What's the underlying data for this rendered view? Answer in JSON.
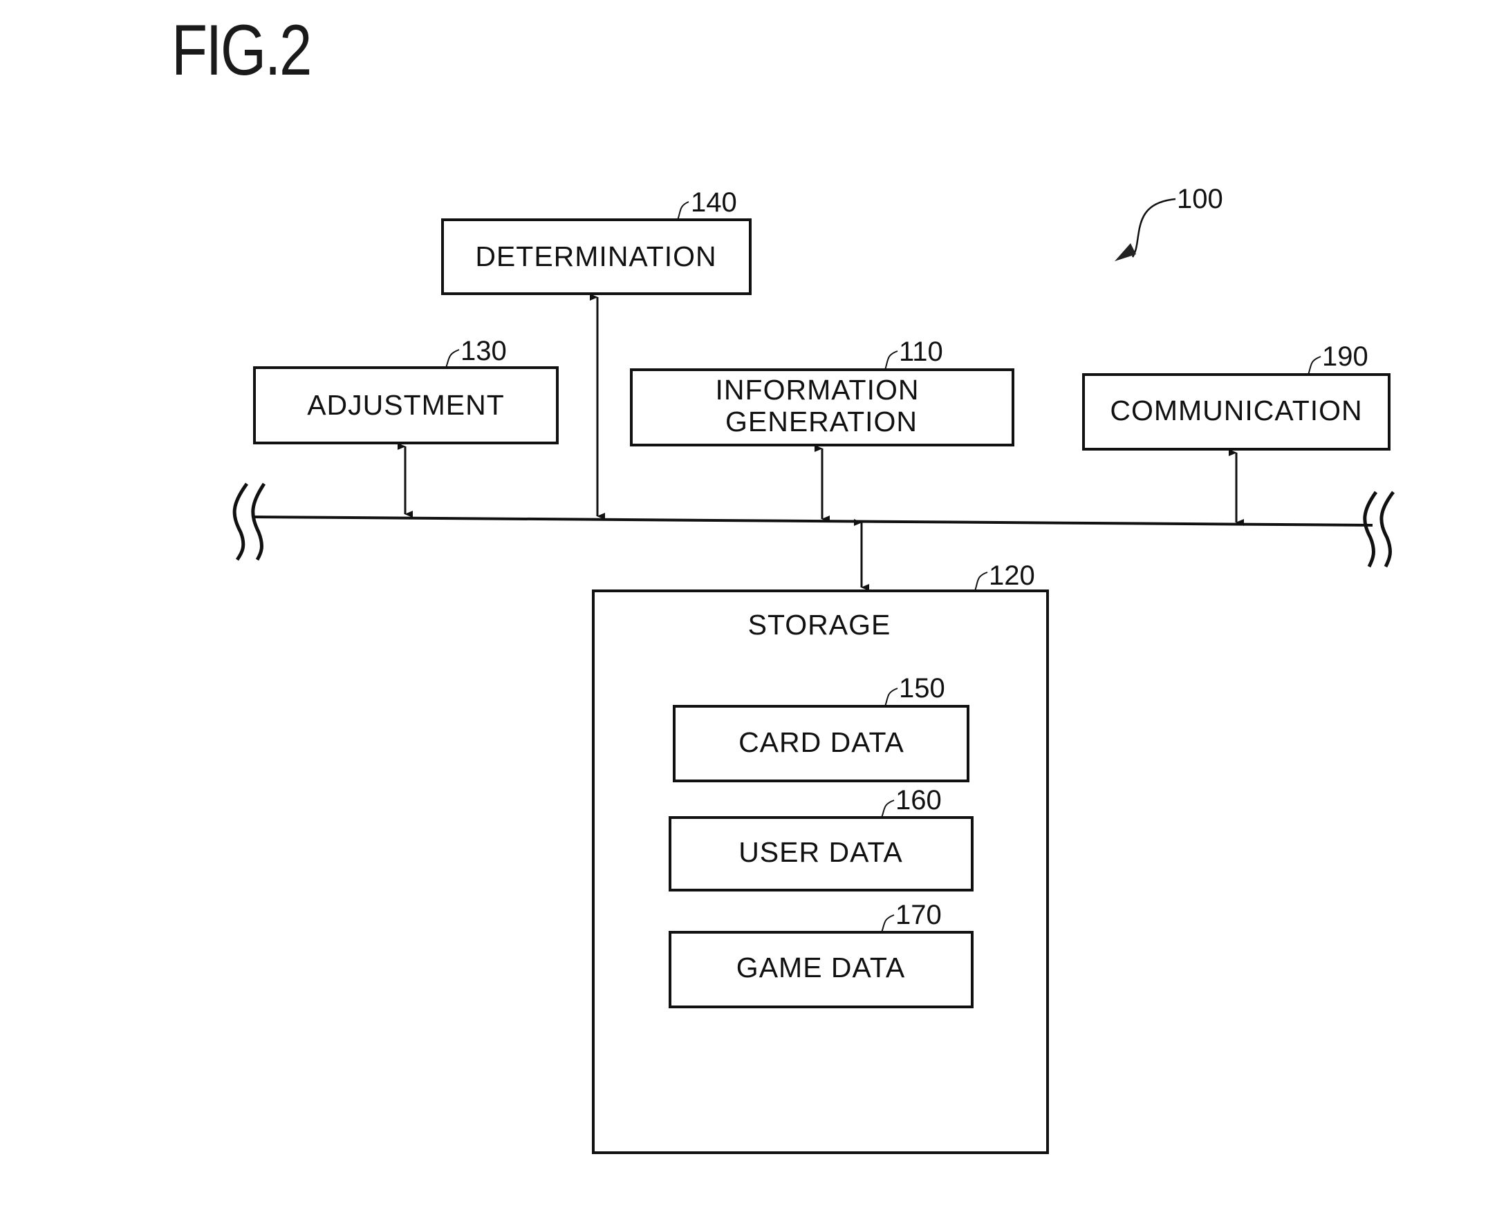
{
  "figure": {
    "title": "FIG.2",
    "system_ref": "100"
  },
  "blocks": {
    "determination": {
      "label": "DETERMINATION",
      "ref": "140"
    },
    "adjustment": {
      "label": "ADJUSTMENT",
      "ref": "130"
    },
    "information_generation": {
      "label_line1": "INFORMATION",
      "label_line2": "GENERATION",
      "ref": "110"
    },
    "communication": {
      "label": "COMMUNICATION",
      "ref": "190"
    },
    "storage": {
      "label": "STORAGE",
      "ref": "120",
      "items": [
        {
          "label": "CARD DATA",
          "ref": "150"
        },
        {
          "label": "USER DATA",
          "ref": "160"
        },
        {
          "label": "GAME DATA",
          "ref": "170"
        }
      ]
    }
  },
  "connections": [
    {
      "from": "adjustment",
      "to": "bus",
      "type": "bidirectional"
    },
    {
      "from": "determination",
      "to": "bus",
      "type": "bidirectional"
    },
    {
      "from": "information_generation",
      "to": "bus",
      "type": "bidirectional"
    },
    {
      "from": "communication",
      "to": "bus",
      "type": "bidirectional"
    },
    {
      "from": "storage",
      "to": "bus",
      "type": "bidirectional"
    }
  ]
}
